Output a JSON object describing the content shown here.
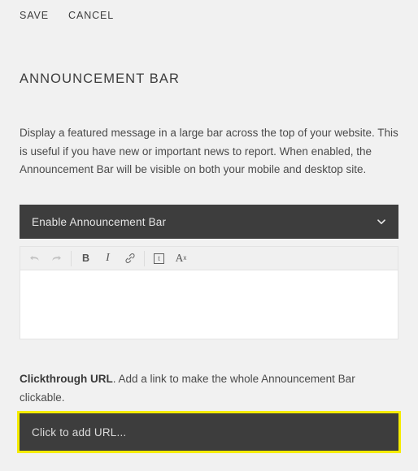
{
  "actions": {
    "save_label": "SAVE",
    "cancel_label": "CANCEL"
  },
  "page": {
    "title": "ANNOUNCEMENT BAR",
    "description": "Display a featured message in a large bar across the top of your website. This is useful if you have new or important news to report. When enabled, the Announcement Bar will be visible on both your mobile and desktop site."
  },
  "enable_select": {
    "value": "Enable Announcement Bar",
    "chevron_icon": "chevron-down-icon"
  },
  "editor": {
    "toolbar": [
      {
        "name": "undo-icon",
        "label": "",
        "disabled": true
      },
      {
        "name": "redo-icon",
        "label": "",
        "disabled": true
      },
      {
        "name": "bold-icon",
        "label": "B",
        "disabled": false
      },
      {
        "name": "italic-icon",
        "label": "I",
        "disabled": false
      },
      {
        "name": "link-icon",
        "label": "",
        "disabled": false
      },
      {
        "name": "text-block-icon",
        "label": "t",
        "disabled": false
      },
      {
        "name": "clear-formatting-icon",
        "label": "A",
        "disabled": false
      }
    ],
    "content": ""
  },
  "clickthrough": {
    "label_bold": "Clickthrough URL",
    "label_rest": ". Add a link to make the whole Announcement Bar clickable.",
    "url_placeholder": "Click to add URL..."
  },
  "colors": {
    "page_background": "#f1f1f1",
    "field_background": "#3d3d3d",
    "highlight": "#f5ec00",
    "text": "#4a4a4a",
    "toolbar_background": "#f0f0f0",
    "editor_background": "#ffffff"
  }
}
